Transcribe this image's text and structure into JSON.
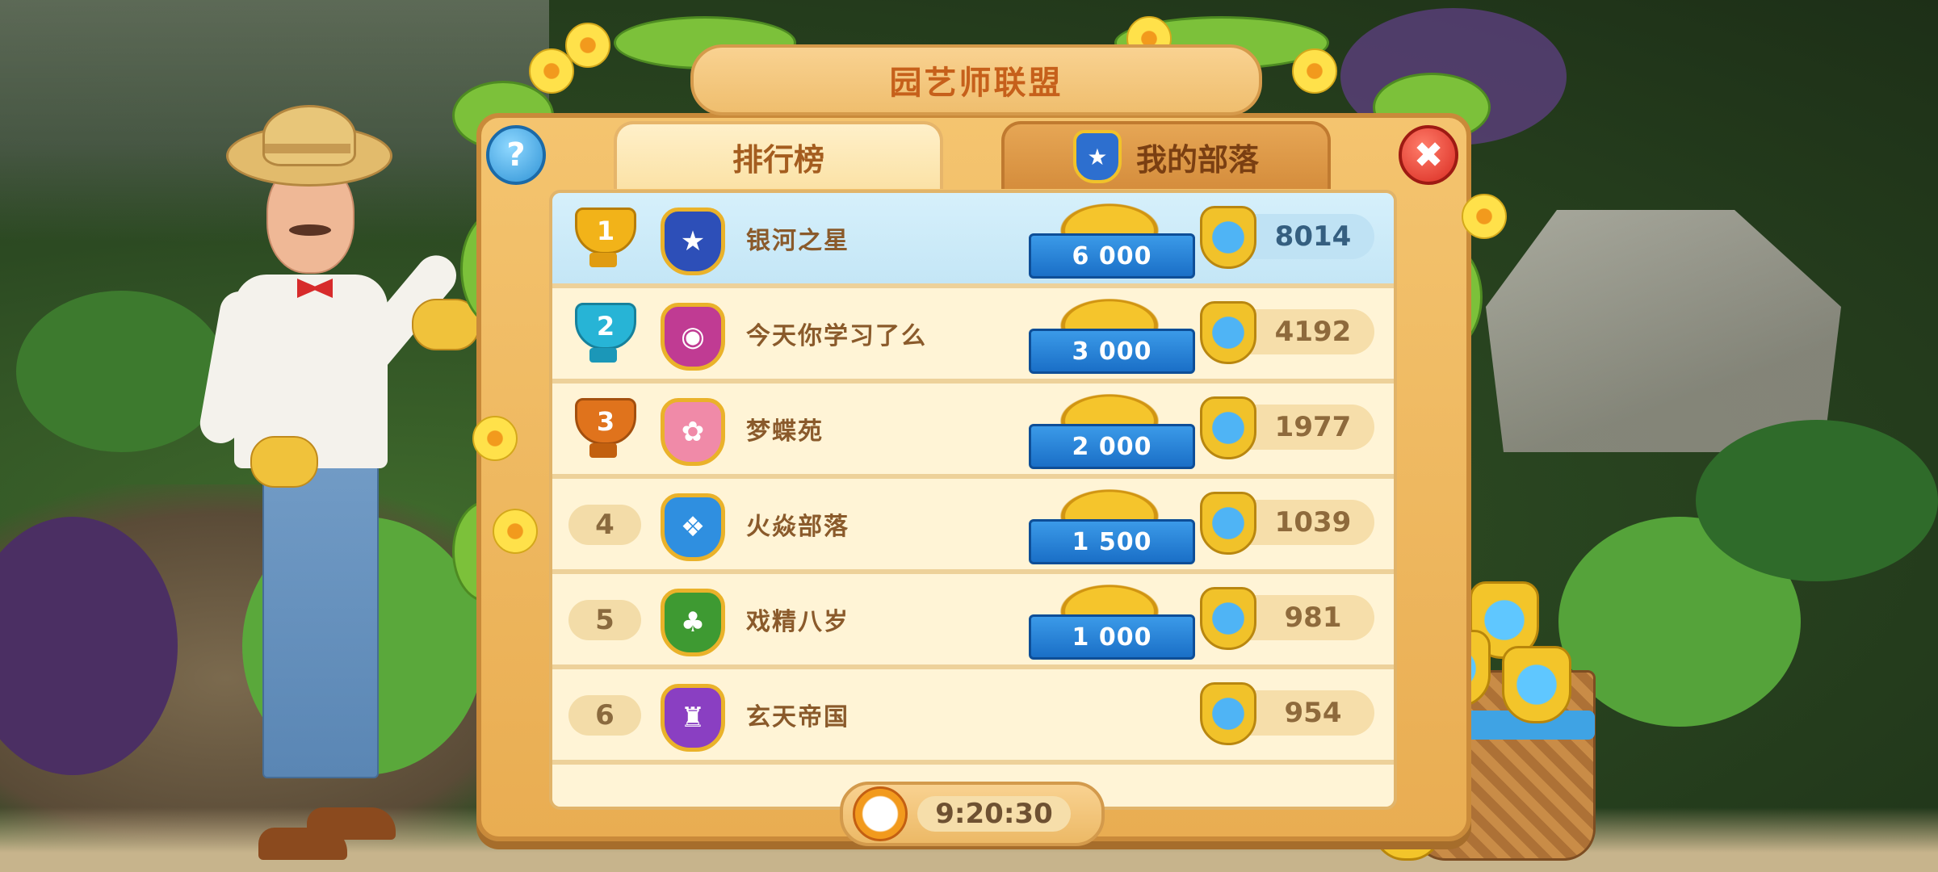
{
  "header": {
    "title": "园艺师联盟"
  },
  "tabs": [
    {
      "label": "排行榜",
      "active": true
    },
    {
      "label": "我的部落",
      "active": false,
      "icon": "star-shield-icon"
    }
  ],
  "buttons": {
    "help_icon": "?",
    "close_icon": "✖"
  },
  "leaderboard": [
    {
      "rank": "1",
      "name": "银河之星",
      "reward": "6 000",
      "score": "8014",
      "badge_icon": "star",
      "badge_color": "#2d4fb8",
      "trophy_color": "#f2b319"
    },
    {
      "rank": "2",
      "name": "今天你学习了么",
      "reward": "3 000",
      "score": "4192",
      "badge_icon": "mask",
      "badge_color": "#c03b93",
      "trophy_color": "#27b4d6"
    },
    {
      "rank": "3",
      "name": "梦蝶苑",
      "reward": "2 000",
      "score": "1977",
      "badge_icon": "flower",
      "badge_color": "#f08aa8",
      "trophy_color": "#e0731c"
    },
    {
      "rank": "4",
      "name": "火焱部落",
      "reward": "1 500",
      "score": "1039",
      "badge_icon": "fish",
      "badge_color": "#2f8fe0"
    },
    {
      "rank": "5",
      "name": "戏精八岁",
      "reward": "1 000",
      "score": "981",
      "badge_icon": "cactus",
      "badge_color": "#3e9a32"
    },
    {
      "rank": "6",
      "name": "玄天帝国",
      "reward": "",
      "score": "954",
      "badge_icon": "top-hat",
      "badge_color": "#8a3fc2"
    }
  ],
  "timer": {
    "value": "9:20:30"
  },
  "colors": {
    "panel": "#f4c46f",
    "highlight_row": "#d6f0fb",
    "ribbon": "#1a6fc7"
  }
}
